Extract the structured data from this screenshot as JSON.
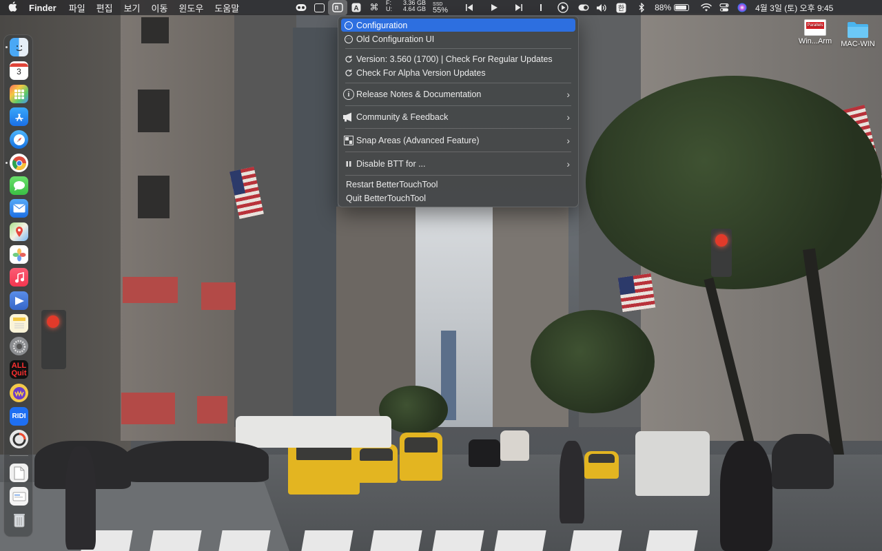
{
  "menubar": {
    "apple_icon": "apple-icon",
    "app_name": "Finder",
    "menus": [
      "파일",
      "편집",
      "보기",
      "이동",
      "윈도우",
      "도움말"
    ],
    "memory": {
      "line1": "3.36 GB",
      "line2": "4.64 GB",
      "prefix1": "F:",
      "prefix2": "U:"
    },
    "ssd": {
      "label": "SSD",
      "value": "55%"
    },
    "battery_percent": "88%",
    "battery_level": 0.88,
    "clock": "4월 3일 (토) 오후 9:45"
  },
  "dropdown": {
    "items": [
      {
        "label": "Configuration",
        "selected": true
      },
      {
        "label": "Old Configuration UI"
      },
      {
        "label": "Version: 3.560 (1700) | Check For Regular Updates"
      },
      {
        "label": "Check For Alpha Version Updates"
      },
      {
        "label": "Release Notes & Documentation"
      },
      {
        "label": "Community & Feedback"
      },
      {
        "label": "Snap Areas (Advanced Feature)"
      },
      {
        "label": "Disable BTT for ..."
      },
      {
        "label": "Restart BetterTouchTool"
      },
      {
        "label": "Quit BetterTouchTool"
      }
    ],
    "submenu_glyph": "›"
  },
  "desktop": {
    "icons": [
      {
        "label": "Win...Arm",
        "badge": "Parallels"
      },
      {
        "label": "MAC-WIN"
      }
    ]
  },
  "dock": {
    "calendar_day": "3",
    "allquit_line1": "ALL",
    "allquit_line2": "Quit",
    "ridi_label": "RIDI"
  },
  "colors": {
    "menu_highlight": "#2d6fe0",
    "menubar_bg": "#28282a",
    "taxi_yellow": "#e3b521"
  }
}
